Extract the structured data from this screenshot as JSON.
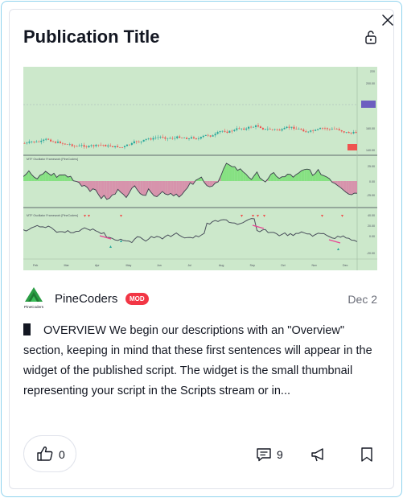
{
  "card": {
    "title": "Publication Title",
    "author": {
      "name": "PineCoders",
      "badge": "MOD",
      "avatar_text": "PineCoders"
    },
    "date": "Dec 2",
    "description": "OVERVIEW We begin our descriptions with an \"Overview\" section, keeping in mind that these first sentences will appear in the widget of the published script. The widget is the small thumbnail representing your script in the Scripts stream or in...",
    "likes": "0",
    "comments": "9"
  },
  "chart_data": {
    "type": "line",
    "panes": [
      {
        "name": "price",
        "label": ""
      },
      {
        "name": "oscillator-1",
        "label": "MTF Oscillator Framework [PineCoders]"
      },
      {
        "name": "oscillator-2",
        "label": "MTF Oscillator Framework [PineCoders]"
      }
    ],
    "x_tick_labels": [
      "Feb",
      "Mar",
      "Apr",
      "May",
      "Jun",
      "Jul",
      "Aug",
      "Sep",
      "Oct",
      "Nov",
      "Dec"
    ],
    "price_axis_labels": [
      "220",
      "200.00",
      "180.00",
      "160.00",
      "140.00"
    ],
    "osc1_axis_labels": [
      "25.00",
      "0.00",
      "-25.00"
    ],
    "osc2_axis_labels": [
      "40.00",
      "20.00",
      "0.00",
      "-20.00"
    ]
  },
  "colors": {
    "chart_bg": "#cce8cb",
    "candle_up": "#26a69a",
    "candle_down": "#ef5350",
    "badge": "#f23645",
    "osc_fill_pos": "#7ee07a",
    "osc_fill_neg": "#d88aa8",
    "frame_border": "#8fd3ee"
  },
  "icons": [
    "close-icon",
    "lock-icon",
    "like-icon",
    "comment-icon",
    "boost-icon",
    "bookmark-icon"
  ]
}
